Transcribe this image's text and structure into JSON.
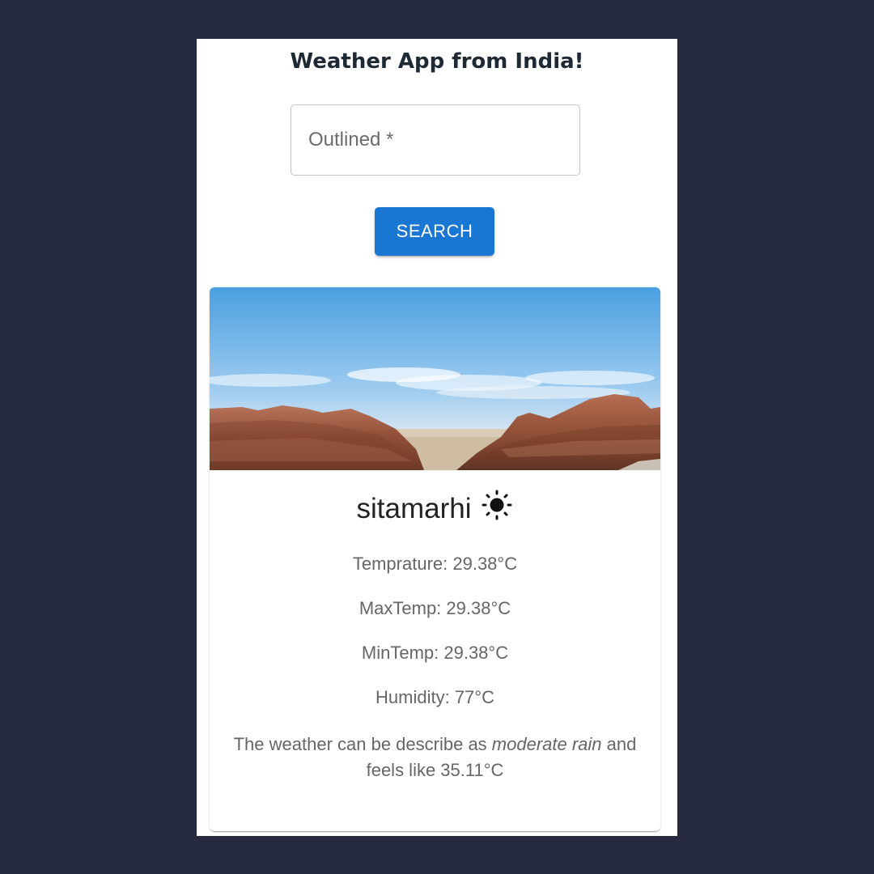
{
  "app": {
    "title": "Weather App from India!"
  },
  "search": {
    "placeholder": "Outlined *",
    "value": "",
    "button_label": "SEARCH"
  },
  "card": {
    "image_icon": "landscape-photo",
    "city": "sitamarhi",
    "weather_icon": "sun-icon",
    "temperature": "Temprature: 29.38°C",
    "max_temp": "MaxTemp: 29.38°C",
    "min_temp": "MinTemp: 29.38°C",
    "humidity": "Humidity: 77°C",
    "description_prefix": "The weather can be describe as ",
    "description_condition": "moderate rain",
    "description_suffix": " and feels like 35.11°C"
  },
  "colors": {
    "background": "#262a3f",
    "accent": "#1976d2",
    "title": "#1e2936"
  }
}
